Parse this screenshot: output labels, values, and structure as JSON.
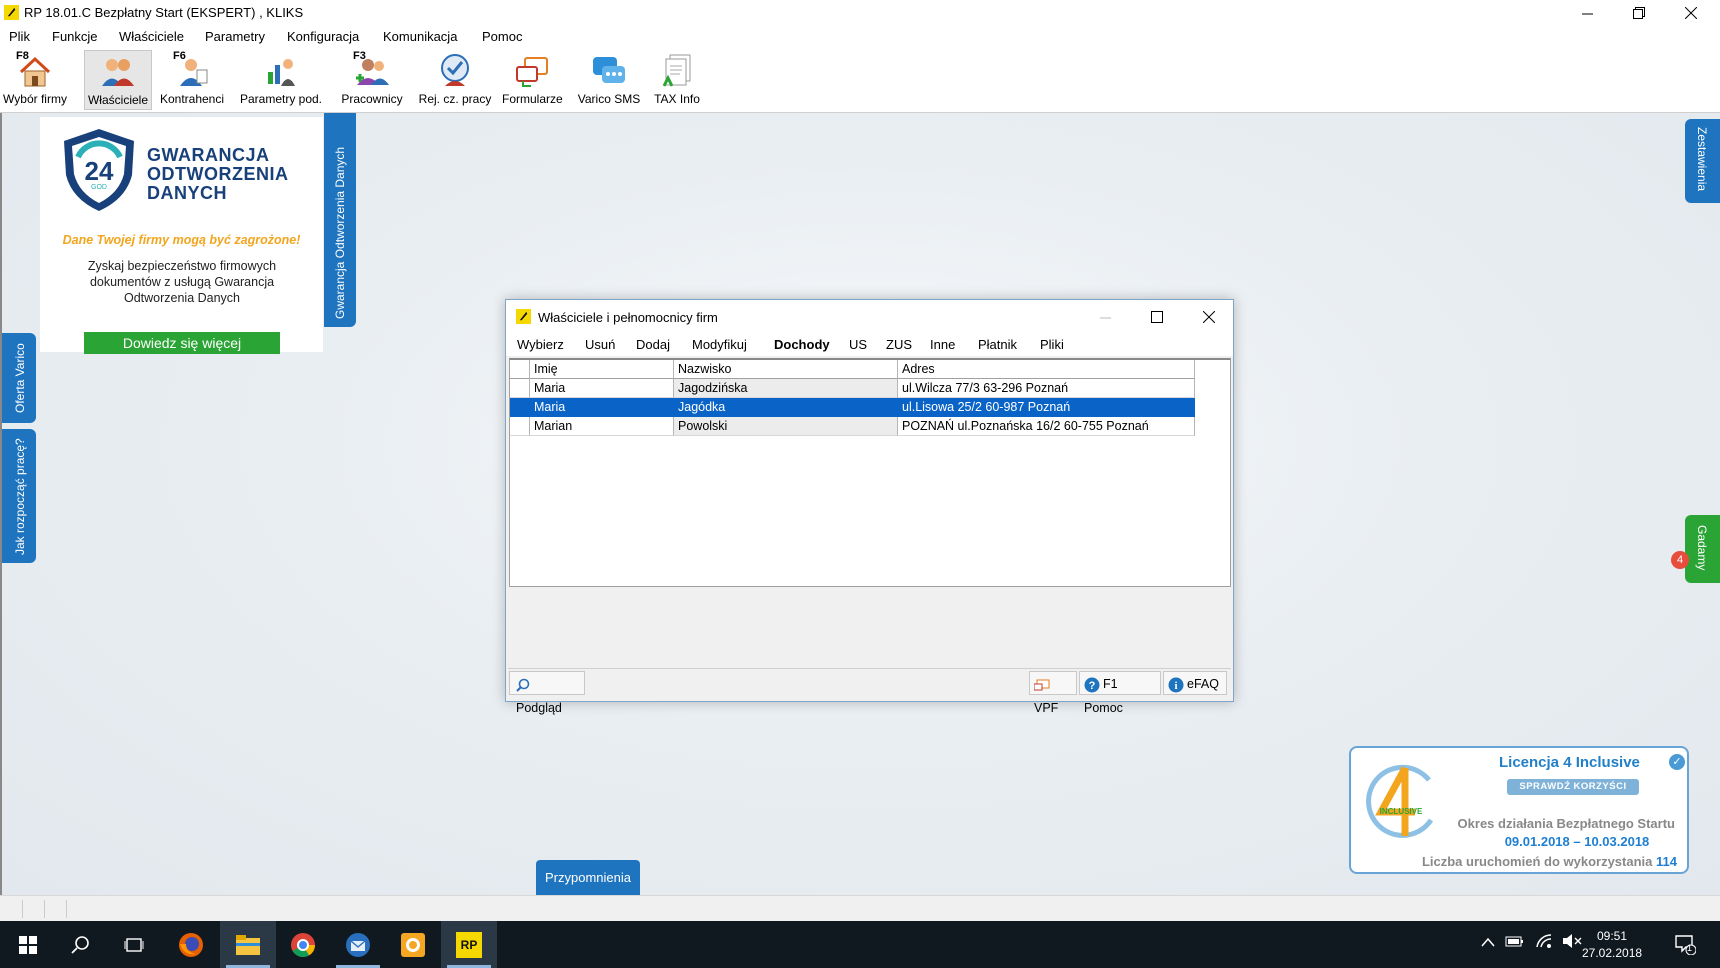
{
  "window": {
    "title": "RP 18.01.C   Bezpłatny Start  (EKSPERT) , KLIKS",
    "controls": [
      "minimize",
      "restore",
      "close"
    ]
  },
  "menubar": {
    "items": [
      "Plik",
      "Funkcje",
      "Właściciele",
      "Parametry",
      "Konfiguracja",
      "Komunikacja",
      "Pomoc"
    ]
  },
  "toolbar": {
    "items": [
      {
        "label": "Wybór firmy",
        "key": "F8",
        "icon": "house-icon"
      },
      {
        "label": "Właściciele",
        "key": "",
        "icon": "owners-icon"
      },
      {
        "label": "Kontrahenci",
        "key": "F6",
        "icon": "contractors-icon"
      },
      {
        "label": "Parametry pod.",
        "key": "",
        "icon": "tax-params-icon"
      },
      {
        "label": "Pracownicy",
        "key": "F3",
        "icon": "employees-icon"
      },
      {
        "label": "Rej. cz. pracy",
        "key": "",
        "icon": "timesheet-icon"
      },
      {
        "label": "Formularze",
        "key": "",
        "icon": "forms-icon"
      },
      {
        "label": "Varico SMS",
        "key": "",
        "icon": "sms-icon"
      },
      {
        "label": "TAX Info",
        "key": "",
        "icon": "tax-info-icon"
      }
    ]
  },
  "ad": {
    "badge_number": "24",
    "badge_sub": "GOD",
    "brand_line1": "GWARANCJA",
    "brand_line2": "ODTWORZENIA",
    "brand_line3": "DANYCH",
    "warning": "Dane Twojej firmy mogą być zagrożone!",
    "description": "Zyskaj bezpieczeństwo firmowych dokumentów z usługą Gwarancja Odtworzenia Danych",
    "cta": "Dowiedz się więcej"
  },
  "side_tabs": {
    "gwarancja": "Gwarancja Odtworzenia Danych",
    "oferta": "Oferta Varico",
    "jak": "Jak rozpocząć pracę?",
    "zestawienia": "Zestawienia",
    "gadamy": "Gadamy",
    "gadamy_badge": "4"
  },
  "dialog": {
    "title": "Właściciele i pełnomocnicy firm",
    "menu": [
      "Wybierz",
      "Usuń",
      "Dodaj",
      "Modyfikuj",
      "Dochody",
      "US",
      "ZUS",
      "Inne",
      "Płatnik",
      "Pliki"
    ],
    "columns": [
      "Imię",
      "Nazwisko",
      "Adres"
    ],
    "rows": [
      {
        "imie": "Maria",
        "nazwisko": "Jagodzińska",
        "adres": "ul.Wilcza 77/3 63-296 Poznań",
        "selected": false
      },
      {
        "imie": "Maria",
        "nazwisko": "Jagódka",
        "adres": "ul.Lisowa 25/2 60-987 Poznań",
        "selected": true
      },
      {
        "imie": "Marian",
        "nazwisko": "Powolski",
        "adres": "POZNAŃ ul.Poznańska 16/2 60-755 Poznań",
        "selected": false
      }
    ],
    "status": {
      "preview": "Podgląd",
      "vpf": "VPF",
      "help": "F1 Pomoc",
      "efaq": "eFAQ"
    }
  },
  "license": {
    "title": "Licencja 4 Inclusive",
    "logo_text": "INCLUSIVE",
    "check_button": "SPRAWDŹ KORZYŚCI",
    "period_label": "Okres działania Bezpłatnego Startu",
    "period": "09.01.2018 – 10.03.2018",
    "launches_label": "Liczba uruchomień do wykorzystania",
    "launches": "114"
  },
  "reminders": {
    "label": "Przypomnienia"
  },
  "taskbar": {
    "apps": [
      "start-icon",
      "search-icon",
      "task-view-icon",
      "firefox-icon",
      "file-explorer-icon",
      "chrome-icon",
      "thunderbird-icon",
      "store-icon",
      "rp-app-icon"
    ],
    "rp_label": "RP",
    "time": "09:51",
    "date": "27.02.2018",
    "notification_count": "1"
  },
  "colors": {
    "accent_blue": "#1e74be",
    "selection_blue": "#0a64c8",
    "cta_green": "#2aa535",
    "warning_orange": "#f2a51d"
  }
}
